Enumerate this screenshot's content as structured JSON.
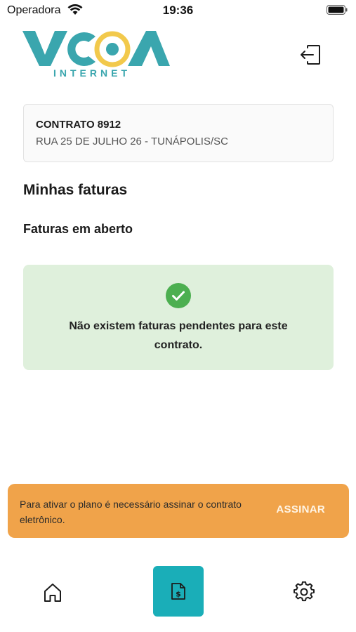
{
  "status_bar": {
    "carrier": "Operadora",
    "time": "19:36"
  },
  "header": {
    "logo_subtitle": "INTERNET",
    "logo_text": "VCOA"
  },
  "contract": {
    "title": "CONTRATO 8912",
    "address": "RUA 25 DE JULHO 26 - TUNÁPOLIS/SC"
  },
  "main": {
    "section_title": "Minhas faturas",
    "subsection_title": "Faturas em aberto",
    "empty_message": "Não existem faturas pendentes para este contrato."
  },
  "banner": {
    "text": "Para ativar o plano é necessário assinar o contrato eletrônico.",
    "button_label": "ASSINAR"
  },
  "tab_bar": {
    "items": [
      {
        "icon": "home-icon",
        "active": false
      },
      {
        "icon": "invoice-dollar-icon",
        "active": true
      },
      {
        "icon": "gear-icon",
        "active": false
      }
    ]
  },
  "colors": {
    "brand_teal": "#3aa6ae",
    "brand_yellow": "#f2c94c",
    "active_tab": "#1aaeb8",
    "success_bg": "#dff0dc",
    "success_icon": "#4caf50",
    "banner_bg": "#f0a34a"
  }
}
